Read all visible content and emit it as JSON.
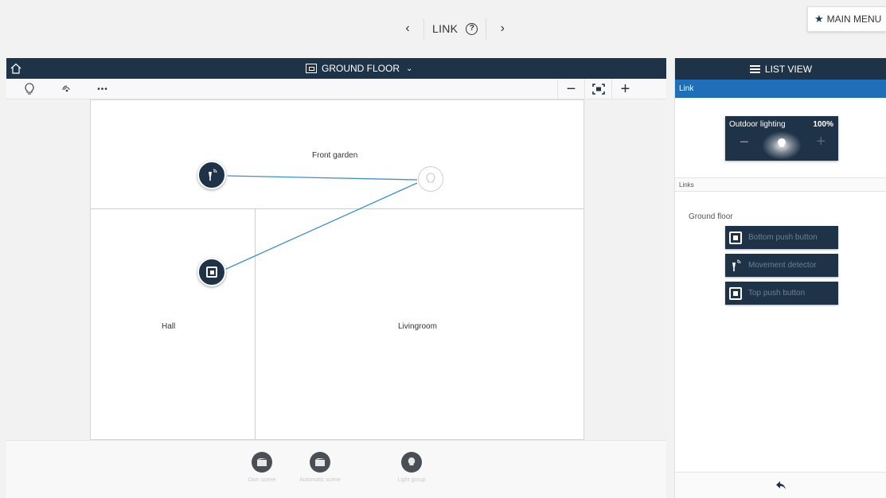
{
  "header": {
    "prev_label": "‹",
    "title": "LINK",
    "help_label": "?",
    "next_label": "›",
    "main_menu_label": "MAIN MENU",
    "main_menu_icon": "star-icon"
  },
  "floor_bar": {
    "home_icon": "home-icon",
    "floor_label": "GROUND FLOOR",
    "dropdown_icon": "chevron-down-icon"
  },
  "toolbar": {
    "lamp_icon": "lightbulb-icon",
    "sensor_icon": "wireless-icon",
    "more_label": "•••",
    "zoom_out_label": "−",
    "zoom_fit_icon": "fit-screen-icon",
    "zoom_in_label": "+"
  },
  "plan": {
    "rooms": [
      {
        "name": "Front garden"
      },
      {
        "name": "Hall"
      },
      {
        "name": "Livingroom"
      }
    ],
    "devices": [
      {
        "type": "movement-detector",
        "icon": "motion-sensor-icon"
      },
      {
        "type": "push-button",
        "icon": "push-button-icon"
      },
      {
        "type": "outdoor-lighting",
        "icon": "lightbulb-icon"
      }
    ],
    "link_color": "#3a8fd0"
  },
  "bottom_bar": {
    "buttons": [
      {
        "label": "Own scene",
        "icon": "scene-icon"
      },
      {
        "label": "Automatic scene",
        "icon": "scene-icon"
      },
      {
        "label": "Light group",
        "icon": "lightbulb-icon"
      }
    ]
  },
  "right_panel": {
    "list_view_label": "LIST VIEW",
    "section_title": "Link",
    "device_tile": {
      "name": "Outdoor lighting",
      "value": "100%",
      "minus_label": "−",
      "plus_label": "+"
    },
    "links_header": "Links",
    "group_label": "Ground floor",
    "link_buttons": [
      {
        "label": "Bottom push button",
        "icon": "push-button-icon"
      },
      {
        "label": "Movement detector",
        "icon": "motion-sensor-icon"
      },
      {
        "label": "Top push button",
        "icon": "push-button-icon"
      }
    ],
    "back_icon": "back-arrow-icon"
  },
  "colors": {
    "navy": "#1f3348",
    "accent_blue": "#1f6fb8",
    "background": "#f2f2f2"
  }
}
